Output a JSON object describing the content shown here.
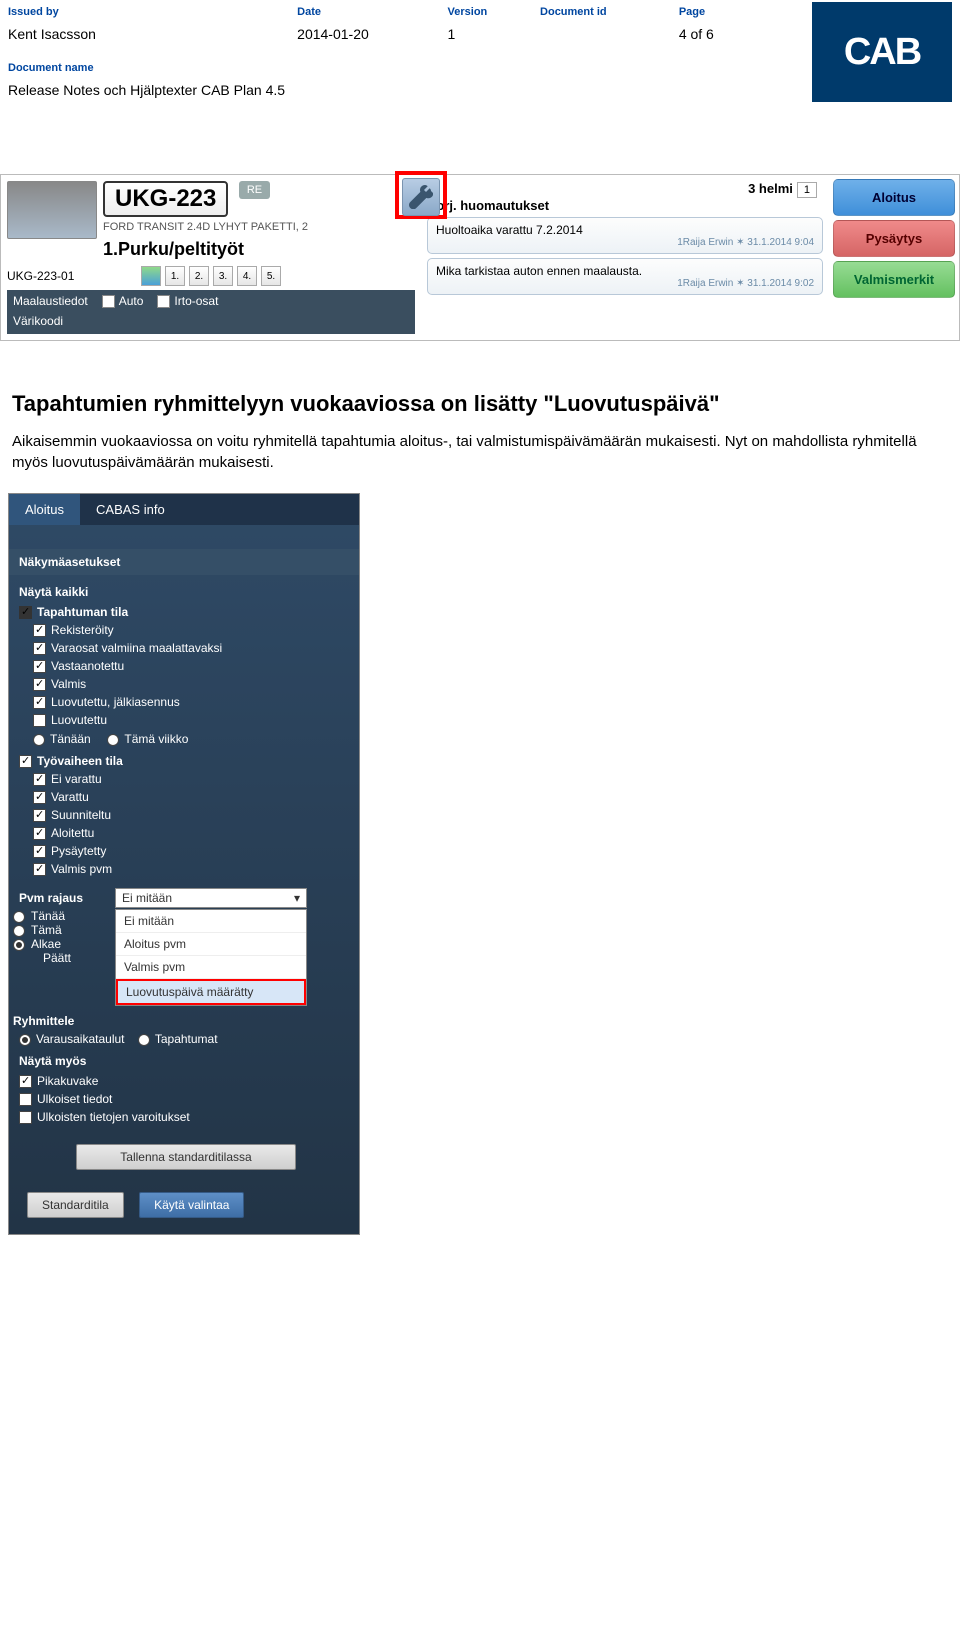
{
  "header": {
    "labels": {
      "issuedBy": "Issued by",
      "date": "Date",
      "version": "Version",
      "documentId": "Document id",
      "page": "Page",
      "documentName": "Document name"
    },
    "issuedBy": "Kent Isacsson",
    "date": "2014-01-20",
    "version": "1",
    "documentId": "",
    "page": "4 of 6",
    "documentName": "Release Notes och Hjälptexter CAB Plan 4.5",
    "logoText": "CAB",
    "registered": "®"
  },
  "shot1": {
    "plate": "UKG-223",
    "reBtn": "RE",
    "vehicleLine": "FORD TRANSIT 2.4D LYHYT PAKETTI, 2",
    "taskTitle": "1.Purku/peltityöt",
    "jobId": "UKG-223-01",
    "miniNumbers": [
      "1.",
      "2.",
      "3.",
      "4.",
      "5."
    ],
    "row3": {
      "a": "Maalaustiedot",
      "b": "Auto",
      "c": "Irto-osat"
    },
    "row4": "Värikoodi",
    "topDate": "3 helmi",
    "topDateBox": "1",
    "notesHeader": "Korj. huomautukset",
    "note1": {
      "text": "Huoltoaika varattu 7.2.2014",
      "meta": "1Raija Erwin  ✶  31.1.2014 9:04"
    },
    "note2": {
      "text": "Mika tarkistaa auton ennen maalausta.",
      "meta": "1Raija Erwin  ✶  31.1.2014 9:02"
    },
    "buttons": {
      "start": "Aloitus",
      "pause": "Pysäytys",
      "done": "Valmismerkit"
    }
  },
  "section": {
    "title": "Tapahtumien ryhmittelyyn vuokaaviossa on lisätty \"Luovutuspäivä\"",
    "body": "Aikaisemmin vuokaaviossa on voitu ryhmitellä tapahtumia aloitus-, tai valmistumispäivämäärän mukaisesti. Nyt on mahdollista ryhmitellä myös luovutuspäivämäärän mukaisesti."
  },
  "shot2": {
    "tabs": {
      "a": "Aloitus",
      "b": "CABAS info"
    },
    "panelTitle": "Näkymäasetukset",
    "showAll": "Näytä kaikki",
    "grp1": {
      "title": "Tapahtuman tila",
      "items": [
        {
          "label": "Rekisteröity",
          "checked": true
        },
        {
          "label": "Varaosat valmiina maalattavaksi",
          "checked": true
        },
        {
          "label": "Vastaanotettu",
          "checked": true
        },
        {
          "label": "Valmis",
          "checked": true
        },
        {
          "label": "Luovutettu, jälkiasennus",
          "checked": true
        },
        {
          "label": "Luovutettu",
          "checked": false
        }
      ],
      "radios": {
        "a": "Tänään",
        "b": "Tämä viikko"
      }
    },
    "grp2": {
      "title": "Työvaiheen tila",
      "checked": true,
      "items": [
        {
          "label": "Ei varattu",
          "checked": true
        },
        {
          "label": "Varattu",
          "checked": true
        },
        {
          "label": "Suunniteltu",
          "checked": true
        },
        {
          "label": "Aloitettu",
          "checked": true
        },
        {
          "label": "Pysäytetty",
          "checked": true
        },
        {
          "label": "Valmis pvm",
          "checked": true
        }
      ]
    },
    "dateFilter": {
      "label": "Pvm rajaus",
      "selected": "Ei mitään",
      "rows": {
        "a": "Tänää",
        "b": "Tämä",
        "c": "Alkae",
        "d": "Päätt"
      },
      "options": [
        "Ei mitään",
        "Aloitus pvm",
        "Valmis pvm",
        "Luovutuspäivä määrätty"
      ]
    },
    "groupBy": {
      "label": "Ryhmittele",
      "a": "Varausaikataulut",
      "b": "Tapahtumat"
    },
    "showAlso": {
      "label": "Näytä myös",
      "items": [
        {
          "label": "Pikakuvake",
          "checked": true
        },
        {
          "label": "Ulkoiset tiedot",
          "checked": false
        },
        {
          "label": "Ulkoisten tietojen varoitukset",
          "checked": false
        }
      ]
    },
    "footer": {
      "saveStd": "Tallenna standarditilassa",
      "std": "Standarditila",
      "apply": "Käytä valintaa"
    }
  }
}
